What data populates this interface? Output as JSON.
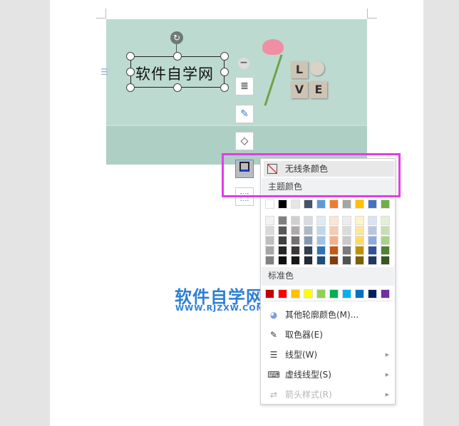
{
  "textbox": {
    "text": "软件自学网"
  },
  "tiles": [
    "L",
    "V",
    "E"
  ],
  "watermark": {
    "title": "软件自学网",
    "url": "WWW.RJZXW.COM"
  },
  "menu": {
    "no_line": "无线条颜色",
    "theme_colors": "主题颜色",
    "standard_colors": "标准色",
    "more_colors": "其他轮廓颜色(M)...",
    "eyedropper": "取色器(E)",
    "line_style": "线型(W)",
    "dash_style": "虚线线型(S)",
    "arrow_style": "箭头样式(R)"
  },
  "theme_top": [
    "#ffffff",
    "#000000",
    "#e7e6e6",
    "#44546a",
    "#5b9bd5",
    "#ed7d31",
    "#a5a5a5",
    "#ffc000",
    "#4472c4",
    "#70ad47"
  ],
  "theme_shades": [
    [
      "#f2f2f2",
      "#d9d9d9",
      "#bfbfbf",
      "#a6a6a6",
      "#808080"
    ],
    [
      "#808080",
      "#595959",
      "#404040",
      "#262626",
      "#0d0d0d"
    ],
    [
      "#d0cece",
      "#aeabab",
      "#757171",
      "#3a3838",
      "#171616"
    ],
    [
      "#d6dce4",
      "#adb9ca",
      "#8497b0",
      "#323f4f",
      "#222a35"
    ],
    [
      "#deebf6",
      "#bdd7ee",
      "#9dc3e6",
      "#2e75b6",
      "#1f4e79"
    ],
    [
      "#fbe5d5",
      "#f8cbad",
      "#f4b183",
      "#c55a11",
      "#843c0b"
    ],
    [
      "#ededed",
      "#dbdbdb",
      "#c9c9c9",
      "#7b7b7b",
      "#525252"
    ],
    [
      "#fff2cc",
      "#ffe699",
      "#ffd966",
      "#bf9000",
      "#7f6000"
    ],
    [
      "#dae3f3",
      "#b4c7e7",
      "#8faadc",
      "#2f5597",
      "#1f3864"
    ],
    [
      "#e2f0d9",
      "#c5e0b4",
      "#a9d18e",
      "#538135",
      "#375623"
    ]
  ],
  "standard": [
    "#c00000",
    "#ff0000",
    "#ffc000",
    "#ffff00",
    "#92d050",
    "#00b050",
    "#00b0f0",
    "#0070c0",
    "#002060",
    "#7030a0"
  ]
}
